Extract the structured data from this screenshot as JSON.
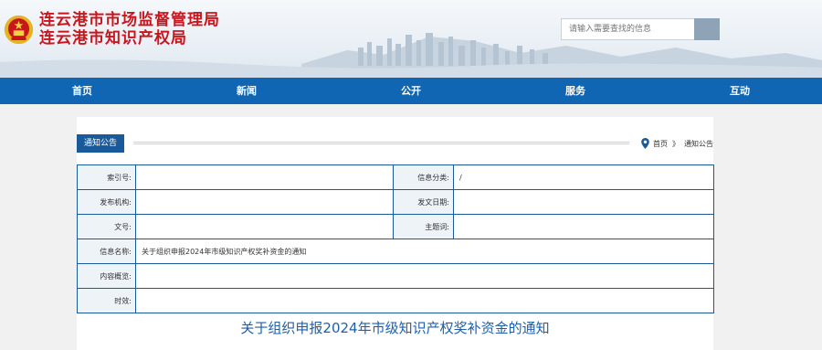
{
  "site": {
    "title_line1": "连云港市市场监督管理局",
    "title_line2": "连云港市知识产权局"
  },
  "search": {
    "placeholder": "请输入需要查找的信息"
  },
  "nav": {
    "items": [
      "首页",
      "新闻",
      "公开",
      "服务",
      "互动"
    ]
  },
  "section": {
    "tag": "通知公告",
    "breadcrumb_home": "首页",
    "breadcrumb_sep": "》",
    "breadcrumb_current": "通知公告"
  },
  "meta": {
    "index_label": "索引号:",
    "index_value": "",
    "category_label": "信息分类:",
    "category_value": "/",
    "publisher_label": "发布机构:",
    "publisher_value": "",
    "date_label": "发文日期:",
    "date_value": "",
    "docno_label": "文号:",
    "docno_value": "",
    "subject_label": "主题词:",
    "subject_value": "",
    "name_label": "信息名称:",
    "name_value": "关于组织申报2024年市级知识产权奖补资金的通知",
    "summary_label": "内容概览:",
    "summary_value": "",
    "validity_label": "时效:",
    "validity_value": ""
  },
  "document": {
    "title": "关于组织申报2024年市级知识产权奖补资金的通知"
  },
  "colors": {
    "nav_bg": "#1166b3",
    "title_red": "#c8161d",
    "table_border": "#1a5a9a",
    "doc_title": "#1f5fa8"
  }
}
